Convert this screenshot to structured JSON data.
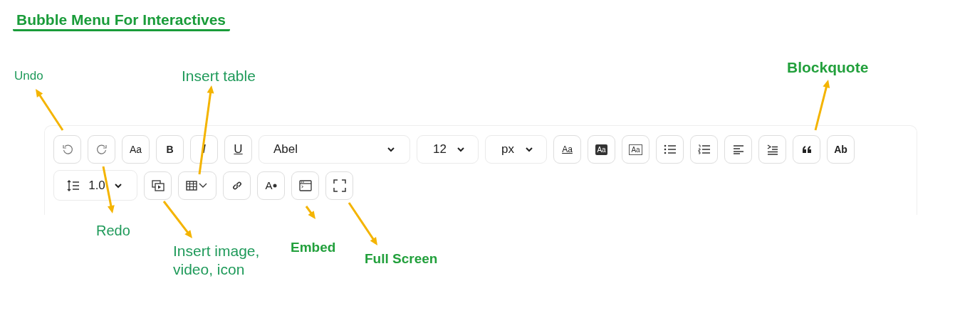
{
  "title": "Bubble Menu For Interactives",
  "toolbar": {
    "rows": [
      [
        {
          "kind": "undo"
        },
        {
          "kind": "redo"
        },
        {
          "kind": "text",
          "label": "Aa"
        },
        {
          "kind": "bold",
          "label": "B"
        },
        {
          "kind": "italic",
          "label": "I"
        },
        {
          "kind": "underline",
          "label": "U"
        },
        {
          "kind": "font-select",
          "value": "Abel"
        },
        {
          "kind": "size-select",
          "value": "12"
        },
        {
          "kind": "unit-select",
          "value": "px"
        },
        {
          "kind": "text-underline",
          "label": "Aa"
        },
        {
          "kind": "text-filled",
          "label": "Aa"
        },
        {
          "kind": "text-boxed",
          "label": "Aa"
        },
        {
          "kind": "bullet-list"
        },
        {
          "kind": "numbered-list"
        },
        {
          "kind": "align-left"
        },
        {
          "kind": "indent"
        },
        {
          "kind": "quote"
        },
        {
          "kind": "bold",
          "label": "Ab"
        }
      ],
      [
        {
          "kind": "line-height",
          "value": "1.0"
        },
        {
          "kind": "media"
        },
        {
          "kind": "table"
        },
        {
          "kind": "link"
        },
        {
          "kind": "text-color",
          "label": "A"
        },
        {
          "kind": "embed"
        },
        {
          "kind": "fullscreen"
        }
      ]
    ]
  },
  "annotations": [
    {
      "label": "Undo",
      "bold": false
    },
    {
      "label": "Insert table",
      "bold": false
    },
    {
      "label": "Blockquote",
      "bold": true
    },
    {
      "label": "Redo",
      "bold": false
    },
    {
      "label": "Insert image, video, icon",
      "bold": false
    },
    {
      "label": "Embed",
      "bold": true
    },
    {
      "label": "Full Screen",
      "bold": true
    }
  ]
}
